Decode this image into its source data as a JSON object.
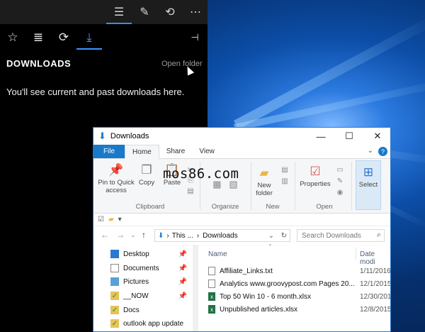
{
  "hub": {
    "title": "DOWNLOADS",
    "open_folder": "Open folder",
    "message": "You'll see current and past downloads here."
  },
  "explorer": {
    "title": "Downloads",
    "window_controls": {
      "minimize": "—",
      "maximize": "☐",
      "close": "✕"
    },
    "ribbon_tabs": [
      "File",
      "Home",
      "Share",
      "View"
    ],
    "ribbon_right": {
      "chevron": "⌄",
      "help": "?"
    },
    "watermark": "mos86.com",
    "ribbon": {
      "clipboard": {
        "pin_label": "Pin to Quick access",
        "copy": "Copy",
        "paste": "Paste",
        "group": "Clipboard"
      },
      "organize": {
        "group": "Organize"
      },
      "new": {
        "new_folder": "New folder",
        "group": "New"
      },
      "open": {
        "properties": "Properties",
        "group": "Open"
      },
      "select": {
        "label": "Select"
      }
    },
    "address": {
      "path": [
        "This ...",
        "Downloads"
      ],
      "search_placeholder": "Search Downloads"
    },
    "nav_items": [
      {
        "label": "Desktop",
        "icon": "desktop-icon",
        "pinned": true
      },
      {
        "label": "Documents",
        "icon": "documents-icon",
        "pinned": true
      },
      {
        "label": "Pictures",
        "icon": "pictures-icon",
        "pinned": true
      },
      {
        "label": "__NOW",
        "icon": "folder-synced-icon",
        "pinned": true
      },
      {
        "label": "Docs",
        "icon": "folder-synced-icon",
        "pinned": false
      },
      {
        "label": "outlook app update",
        "icon": "folder-synced-icon",
        "pinned": false
      }
    ],
    "columns": {
      "name": "Name",
      "date": "Date modi"
    },
    "files": [
      {
        "name": "Affiliate_Links.txt",
        "date": "1/11/2016",
        "type": "txt"
      },
      {
        "name": "Analytics www.groovypost.com Pages 20...",
        "date": "12/1/2015",
        "type": "txt"
      },
      {
        "name": "Top 50 Win 10 - 6 month.xlsx",
        "date": "12/30/2015",
        "type": "xlsx"
      },
      {
        "name": "Unpublished articles.xlsx",
        "date": "12/8/2015",
        "type": "xlsx"
      }
    ]
  },
  "colors": {
    "accent": "#3b96ff",
    "file_tab": "#1979ca",
    "excel": "#1f7244"
  }
}
